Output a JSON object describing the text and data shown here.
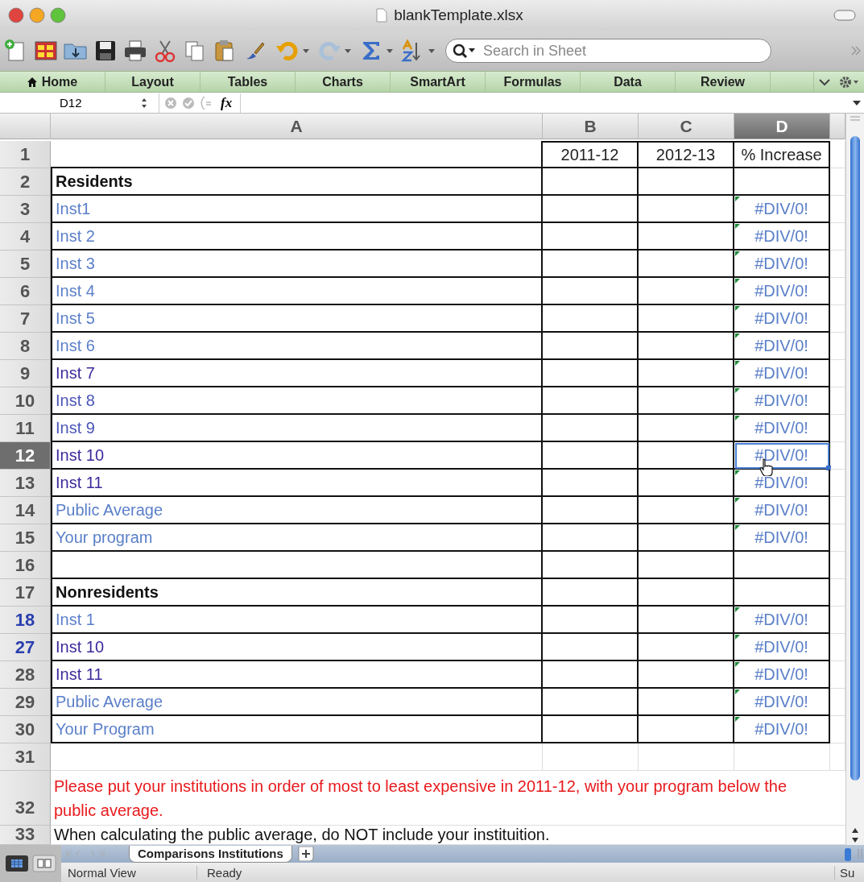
{
  "window": {
    "title": "blankTemplate.xlsx"
  },
  "toolbar": {
    "search": {
      "placeholder": "Search in Sheet"
    }
  },
  "ribbon": {
    "tabs": [
      {
        "label": "Home",
        "selected": false
      },
      {
        "label": "Layout",
        "selected": false
      },
      {
        "label": "Tables",
        "selected": false
      },
      {
        "label": "Charts",
        "selected": false
      },
      {
        "label": "SmartArt",
        "selected": false
      },
      {
        "label": "Formulas",
        "selected": false
      },
      {
        "label": "Data",
        "selected": false
      },
      {
        "label": "Review",
        "selected": false
      }
    ]
  },
  "formula_bar": {
    "name_box": "D12",
    "function_label": "fx"
  },
  "columns": [
    {
      "label": "A",
      "selected": false
    },
    {
      "label": "B",
      "selected": false
    },
    {
      "label": "C",
      "selected": false
    },
    {
      "label": "D",
      "selected": true
    }
  ],
  "rows": [
    {
      "number": "1",
      "selected": false,
      "after_hidden": false,
      "kind": "table",
      "b": "2011-12",
      "c": "2012-13",
      "d": "% Increase"
    },
    {
      "number": "2",
      "selected": false,
      "after_hidden": false,
      "kind": "table",
      "a": "Residents",
      "color": "#111111",
      "bold": true
    },
    {
      "number": "3",
      "selected": false,
      "after_hidden": false,
      "kind": "table",
      "a": "Inst1",
      "color": "#5a7fc9",
      "d": "#DIV/0!",
      "flag": true
    },
    {
      "number": "4",
      "selected": false,
      "after_hidden": false,
      "kind": "table",
      "a": "Inst 2",
      "color": "#5a7fc9",
      "d": "#DIV/0!",
      "flag": true
    },
    {
      "number": "5",
      "selected": false,
      "after_hidden": false,
      "kind": "table",
      "a": "Inst 3",
      "color": "#5a7fc9",
      "d": "#DIV/0!",
      "flag": true
    },
    {
      "number": "6",
      "selected": false,
      "after_hidden": false,
      "kind": "table",
      "a": "Inst 4",
      "color": "#5a7fc9",
      "d": "#DIV/0!",
      "flag": true
    },
    {
      "number": "7",
      "selected": false,
      "after_hidden": false,
      "kind": "table",
      "a": "Inst 5",
      "color": "#5a7fc9",
      "d": "#DIV/0!",
      "flag": true
    },
    {
      "number": "8",
      "selected": false,
      "after_hidden": false,
      "kind": "table",
      "a": "Inst 6",
      "color": "#5a7fc9",
      "d": "#DIV/0!",
      "flag": true
    },
    {
      "number": "9",
      "selected": false,
      "after_hidden": false,
      "kind": "table",
      "a": "Inst 7",
      "color": "#3b2a9c",
      "d": "#DIV/0!",
      "flag": true
    },
    {
      "number": "10",
      "selected": false,
      "after_hidden": false,
      "kind": "table",
      "a": "Inst 8",
      "color": "#4a55b8",
      "d": "#DIV/0!",
      "flag": true
    },
    {
      "number": "11",
      "selected": false,
      "after_hidden": false,
      "kind": "table",
      "a": "Inst 9",
      "color": "#4a55b8",
      "d": "#DIV/0!",
      "flag": true
    },
    {
      "number": "12",
      "selected": true,
      "after_hidden": false,
      "kind": "table",
      "a": "Inst 10",
      "color": "#3b2a9c",
      "d": "#DIV/0!",
      "flag": false,
      "active": true,
      "cursor": true
    },
    {
      "number": "13",
      "selected": false,
      "after_hidden": false,
      "kind": "table",
      "a": "Inst 11",
      "color": "#3b2a9c",
      "d": "#DIV/0!",
      "flag": true
    },
    {
      "number": "14",
      "selected": false,
      "after_hidden": false,
      "kind": "table",
      "a": "Public Average",
      "color": "#5a7fc9",
      "d": "#DIV/0!",
      "flag": true
    },
    {
      "number": "15",
      "selected": false,
      "after_hidden": false,
      "kind": "table",
      "a": "Your program",
      "color": "#5a7fc9",
      "d": "#DIV/0!",
      "flag": true
    },
    {
      "number": "16",
      "selected": false,
      "after_hidden": false,
      "kind": "table"
    },
    {
      "number": "17",
      "selected": false,
      "after_hidden": false,
      "kind": "table",
      "a": "Nonresidents",
      "color": "#111111",
      "bold": true
    },
    {
      "number": "18",
      "selected": false,
      "after_hidden": true,
      "kind": "table",
      "a": "Inst 1",
      "color": "#5a7fc9",
      "d": "#DIV/0!",
      "flag": true
    },
    {
      "number": "27",
      "selected": false,
      "after_hidden": true,
      "kind": "table",
      "a": "Inst 10",
      "color": "#3b2a9c",
      "d": "#DIV/0!",
      "flag": true
    },
    {
      "number": "28",
      "selected": false,
      "after_hidden": false,
      "kind": "table",
      "a": "Inst 11",
      "color": "#3b2a9c",
      "d": "#DIV/0!",
      "flag": true
    },
    {
      "number": "29",
      "selected": false,
      "after_hidden": false,
      "kind": "table",
      "a": "Public Average",
      "color": "#5a7fc9",
      "d": "#DIV/0!",
      "flag": true
    },
    {
      "number": "30",
      "selected": false,
      "after_hidden": false,
      "kind": "table",
      "a": "Your Program",
      "color": "#5a7fc9",
      "d": "#DIV/0!",
      "flag": true
    },
    {
      "number": "31",
      "selected": false,
      "after_hidden": false,
      "kind": "plain"
    },
    {
      "number": "32",
      "selected": false,
      "after_hidden": false,
      "kind": "note",
      "a": "Please put your institutions in order of most to least expensive in 2011-12, with your program below the public average.",
      "color": "#e8191c"
    },
    {
      "number": "33",
      "selected": false,
      "after_hidden": false,
      "kind": "last",
      "a": "When calculating the public average, do NOT include your instituition.",
      "color": "#111111"
    }
  ],
  "sheet_tabs": [
    {
      "label": "Comparisons Institutions",
      "selected": true
    }
  ],
  "status_bar": {
    "view": "Normal View",
    "state": "Ready",
    "extra": "Su"
  }
}
